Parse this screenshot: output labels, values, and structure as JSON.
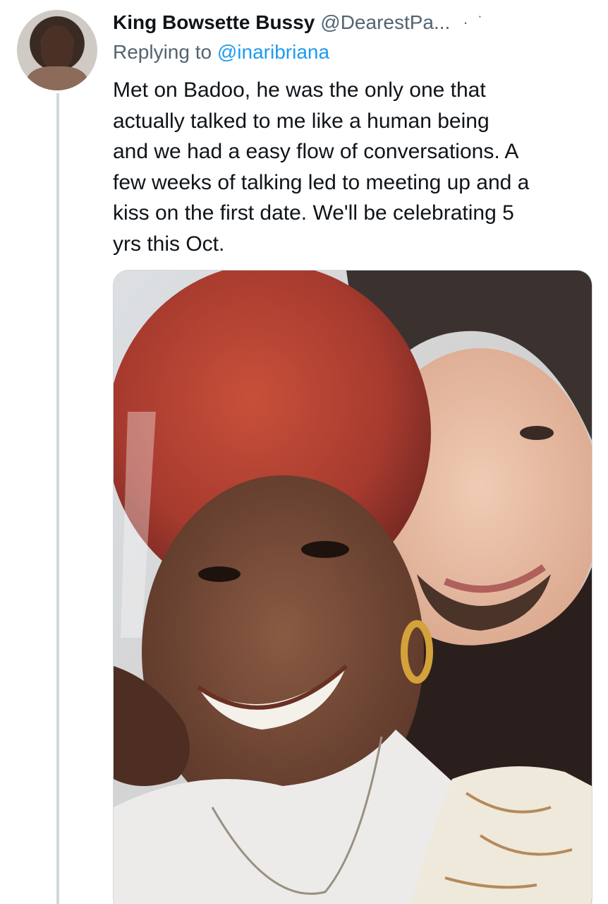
{
  "author": {
    "display_name": "King Bowsette Bussy",
    "handle": "@DearestPa...",
    "avatar_icon": "profile-photo-avatar"
  },
  "reply": {
    "prefix": "Replying to",
    "mention": "@inaribriana"
  },
  "tweet": {
    "lines": [
      "Met on Badoo, he was the only one that",
      "actually talked to me like a human being",
      "and we had a easy flow of conversations. A",
      "few weeks of talking led to meeting up and a",
      "kiss on the first date. We'll be celebrating 5",
      "yrs this Oct."
    ]
  },
  "menu": {
    "icon": "more-options-icon",
    "glyph": "· ˙"
  },
  "colors": {
    "text": "#0f1419",
    "secondary": "#536471",
    "link": "#1d9bf0",
    "thread_line": "#cfd9de"
  }
}
